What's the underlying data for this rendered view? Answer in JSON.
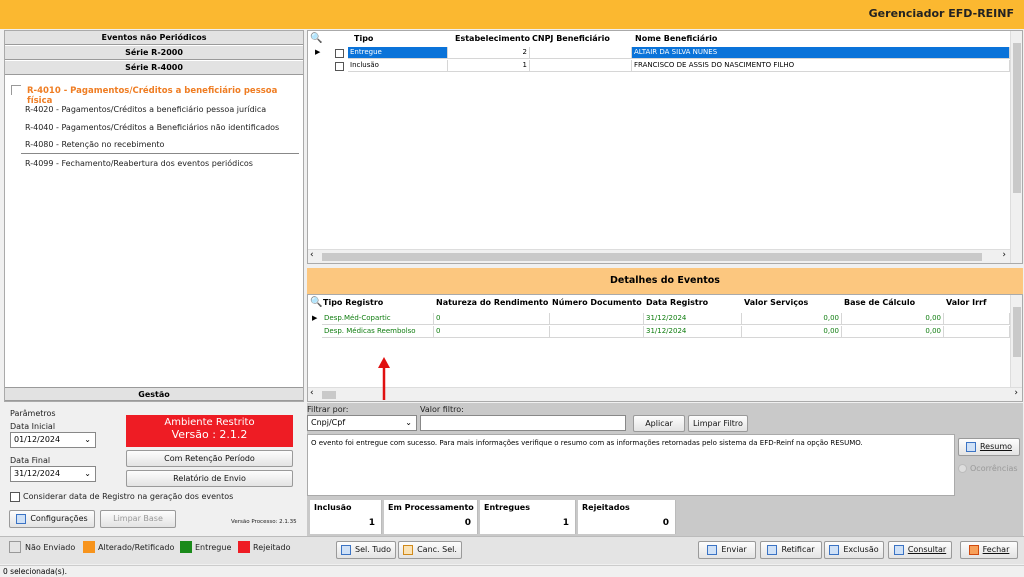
{
  "app": {
    "title": "Gerenciador EFD-REINF"
  },
  "left": {
    "sections": [
      "Eventos não Periódicos",
      "Série R-2000",
      "Série R-4000"
    ],
    "items": [
      {
        "label": "R-4010 - Pagamentos/Créditos a beneficiário pessoa física",
        "active": true
      },
      {
        "label": "R-4020 - Pagamentos/Créditos a beneficiário pessoa jurídica"
      },
      {
        "label": "R-4040 - Pagamentos/Créditos a Beneficiários não identificados"
      },
      {
        "label": "R-4080 - Retenção no recebimento"
      },
      {
        "label": "R-4099 - Fechamento/Reabertura dos eventos periódicos"
      }
    ],
    "gestao": "Gestão"
  },
  "params": {
    "title": "Parâmetros",
    "data_inicial_label": "Data Inicial",
    "data_inicial": "01/12/2024",
    "data_final_label": "Data Final",
    "data_final": "31/12/2024",
    "ambiente": "Ambiente Restrito",
    "versao": "Versão : 2.1.2",
    "btn_retencao": "Com Retenção Período",
    "btn_relatorio": "Relatório de Envio",
    "checkbox_label": "Considerar data de Registro na geração dos eventos",
    "btn_config": "Configurações",
    "btn_limpar": "Limpar Base",
    "versao_processo": "Versão Processo: 2.1.35"
  },
  "events_grid": {
    "columns": [
      "Tipo",
      "Estabelecimento",
      "CNPJ Beneficiário",
      "Nome Beneficiário"
    ],
    "rows": [
      {
        "tipo": "Entregue",
        "estab": "2",
        "cnpj": "",
        "nome": "ALTAIR DA SILVA NUNES"
      },
      {
        "tipo": "Inclusão",
        "estab": "1",
        "cnpj": "",
        "nome": "FRANCISCO DE ASSIS DO NASCIMENTO FILHO"
      }
    ]
  },
  "details": {
    "title": "Detalhes do Eventos",
    "columns": [
      "Tipo Registro",
      "Natureza do Rendimento",
      "Número Documento",
      "Data Registro",
      "Valor Serviços",
      "Base de Cálculo",
      "Valor Irrf"
    ],
    "rows": [
      {
        "tipo": "Desp.Méd-Copartic",
        "natureza": "0",
        "doc": "",
        "data": "31/12/2024",
        "valor": "0,00",
        "base": "0,00"
      },
      {
        "tipo": "Desp. Médicas Reembolso",
        "natureza": "0",
        "doc": "",
        "data": "31/12/2024",
        "valor": "0,00",
        "base": "0,00"
      }
    ]
  },
  "filter": {
    "filtrar_label": "Filtrar por:",
    "filtrar_value": "Cnpj/Cpf",
    "valor_label": "Valor filtro:",
    "valor_value": "",
    "btn_aplicar": "Aplicar",
    "btn_limpar": "Limpar Filtro"
  },
  "message": "O evento foi entregue com sucesso. Para mais informações verifique o resumo com as informações retornadas pelo sistema da EFD-Reinf na opção RESUMO.",
  "side_buttons": {
    "resumo": "Resumo",
    "ocorrencias": "Ocorrências"
  },
  "counters": [
    {
      "label": "Inclusão",
      "value": "1"
    },
    {
      "label": "Em Processamento",
      "value": "0"
    },
    {
      "label": "Entregues",
      "value": "1"
    },
    {
      "label": "Rejeitados",
      "value": "0"
    }
  ],
  "legend": [
    {
      "label": "Não Enviado",
      "color": "#ffffff"
    },
    {
      "label": "Alterado/Retificado",
      "color": "#f7941d"
    },
    {
      "label": "Entregue",
      "color": "#1a8a1a"
    },
    {
      "label": "Rejeitado",
      "color": "#ee1c24"
    }
  ],
  "selection_buttons": {
    "sel_tudo": "Sel. Tudo",
    "canc_sel": "Canc. Sel."
  },
  "actions": {
    "enviar": "Enviar",
    "retificar": "Retificar",
    "exclusao": "Exclusão",
    "consultar": "Consultar",
    "fechar": "Fechar"
  },
  "status": "0 selecionada(s)."
}
